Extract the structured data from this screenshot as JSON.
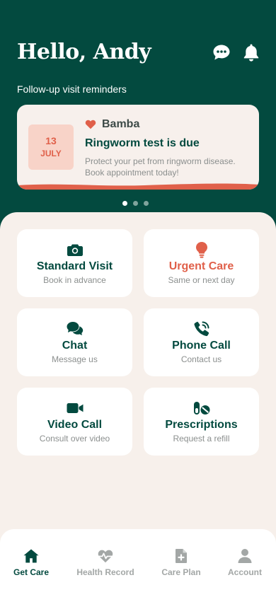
{
  "header": {
    "greeting": "Hello, Andy",
    "chat_icon": "chat-bubble-icon",
    "notification_icon": "bell-icon"
  },
  "reminders": {
    "section_title": "Follow-up visit reminders",
    "items": [
      {
        "day": "13",
        "month": "JULY",
        "pet_name": "Bamba",
        "title": "Ringworm test is due",
        "body": "Protect your pet from ringworm disease. Book appointment today!"
      }
    ],
    "page_count": 3,
    "active_page": 1
  },
  "care_options": [
    {
      "title": "Standard Visit",
      "subtitle": "Book in advance",
      "icon": "camera-icon",
      "urgent": false
    },
    {
      "title": "Urgent Care",
      "subtitle": "Same or next day",
      "icon": "lightbulb-icon",
      "urgent": true
    },
    {
      "title": "Chat",
      "subtitle": "Message us",
      "icon": "chat-icon",
      "urgent": false
    },
    {
      "title": "Phone Call",
      "subtitle": "Contact us",
      "icon": "phone-icon",
      "urgent": false
    },
    {
      "title": "Video Call",
      "subtitle": "Consult over video",
      "icon": "video-icon",
      "urgent": false
    },
    {
      "title": "Prescriptions",
      "subtitle": "Request a refill",
      "icon": "pills-icon",
      "urgent": false
    }
  ],
  "nav": {
    "items": [
      {
        "label": "Get Care",
        "icon": "home-icon",
        "active": true
      },
      {
        "label": "Health Record",
        "icon": "heart-pulse-icon",
        "active": false
      },
      {
        "label": "Care Plan",
        "icon": "medical-file-icon",
        "active": false
      },
      {
        "label": "Account",
        "icon": "user-icon",
        "active": false
      }
    ]
  },
  "colors": {
    "brand": "#034a3f",
    "accent": "#e0604a",
    "background": "#f7f0eb",
    "date_tile": "#f8d3c8",
    "muted_text": "#8b8f8e"
  }
}
